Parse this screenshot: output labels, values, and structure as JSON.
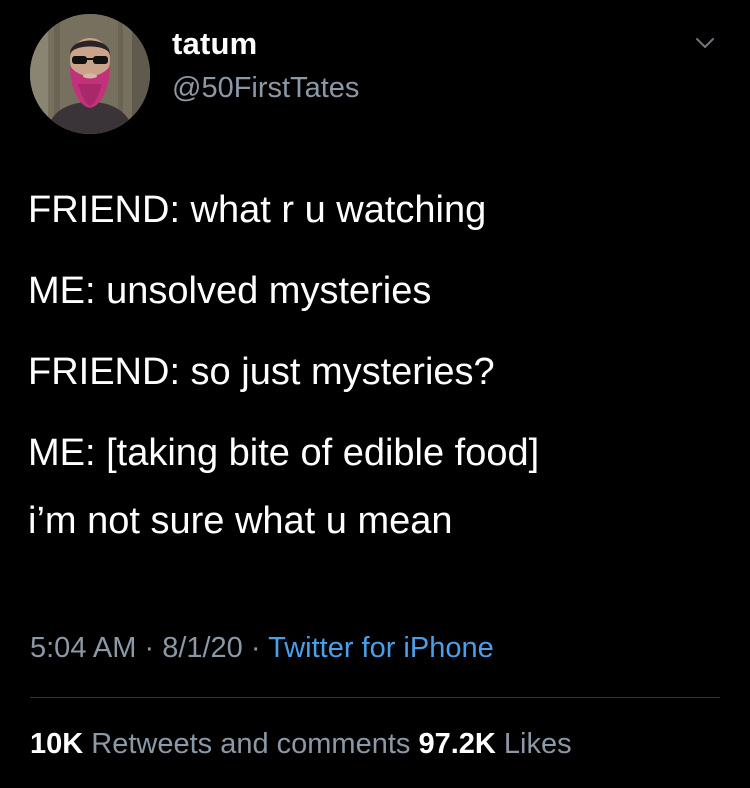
{
  "author": {
    "display_name": "tatum",
    "handle": "@50FirstTates",
    "avatar_icon": "bearded-man-avatar-icon"
  },
  "menu_icon": "chevron-down-icon",
  "tweet": {
    "lines": [
      "FRIEND: what r u watching",
      "ME: unsolved mysteries",
      "FRIEND: so just mysteries?",
      "ME: [taking bite of edible food]",
      "i’m not sure what u mean"
    ]
  },
  "meta": {
    "time": "5:04 AM",
    "separator": " · ",
    "date": "8/1/20",
    "source": "Twitter for iPhone"
  },
  "stats": {
    "retweets_count": "10K",
    "retweets_label": " Retweets and comments ",
    "likes_count": "97.2K",
    "likes_label": " Likes"
  },
  "colors": {
    "background": "#000000",
    "text": "#ffffff",
    "secondary": "#8b98a5",
    "link": "#4a9fe8"
  }
}
